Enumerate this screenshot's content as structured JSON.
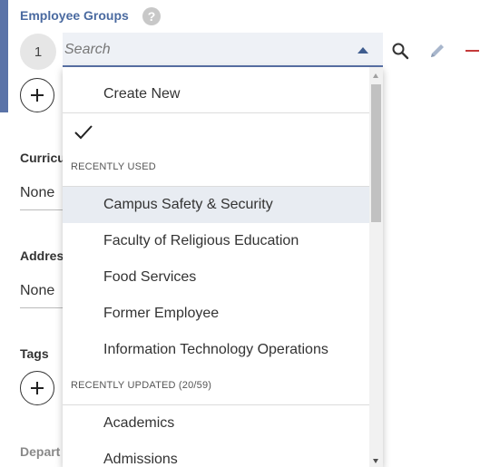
{
  "employee_groups": {
    "label": "Employee Groups",
    "help_glyph": "?",
    "index": "1",
    "search_placeholder": "Search"
  },
  "fields": [
    {
      "label": "Curricu",
      "value": "None"
    },
    {
      "label": "Addres",
      "value": "None"
    },
    {
      "label": "Tags"
    },
    {
      "label": "Depart"
    }
  ],
  "dropdown": {
    "create_new": "Create New",
    "recently_used_header": "RECENTLY USED",
    "recently_used": [
      "Campus Safety & Security",
      "Faculty of Religious Education",
      "Food Services",
      "Former Employee",
      "Information Technology Operations"
    ],
    "recently_updated_header": "RECENTLY UPDATED (20/59)",
    "recently_updated": [
      "Academics",
      "Admissions"
    ]
  },
  "colors": {
    "accent": "#5a73a8",
    "delete": "#c43a3a",
    "hover": "#e8ecf2"
  }
}
